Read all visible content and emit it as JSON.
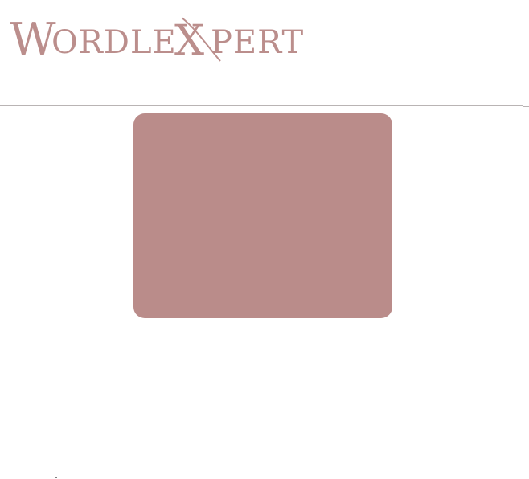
{
  "brand": {
    "logo_text": "WORDLEXPERT",
    "logo_color": "#bb8e8c"
  },
  "colors": {
    "card": "#ba8c8a",
    "divider": "#b9b4b4",
    "background": "#ffffff"
  }
}
